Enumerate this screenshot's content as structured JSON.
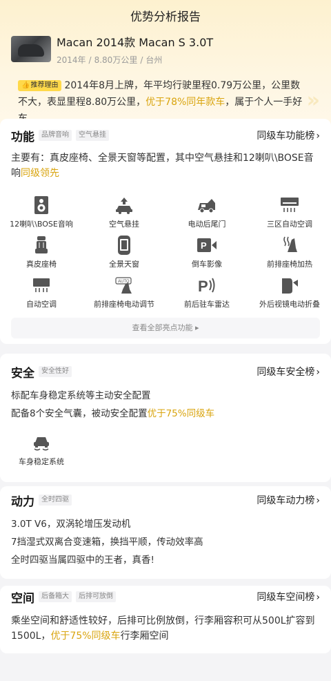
{
  "header": {
    "title": "优势分析报告"
  },
  "car": {
    "name": "Macan 2014款 Macan S 3.0T",
    "year": "2014年",
    "mileage": "8.80万公里",
    "city": "台州"
  },
  "recommend": {
    "badge": "推荐理由",
    "text_before": "2014年8月上牌，年平均行驶里程0.79万公里，公里数不大，表显里程8.80万公里，",
    "highlight": "优于78%同年款车",
    "text_after": "，属于个人一手好车"
  },
  "function_section": {
    "title": "功能",
    "tags": [
      "品牌音响",
      "空气悬挂"
    ],
    "rank_label": "同级车功能榜",
    "desc_before": "主要有：真皮座椅、全景天窗等配置，其中空气悬挂和12喇叭\\BOSE音响",
    "desc_highlight": "同级领先",
    "features": [
      {
        "label": "12喇叭\\BOSE音响",
        "icon": "speaker-icon"
      },
      {
        "label": "空气悬挂",
        "icon": "air-suspension-icon"
      },
      {
        "label": "电动后尾门",
        "icon": "power-tailgate-icon"
      },
      {
        "label": "三区自动空调",
        "icon": "tri-zone-ac-icon"
      },
      {
        "label": "真皮座椅",
        "icon": "leather-seat-icon"
      },
      {
        "label": "全景天窗",
        "icon": "panoramic-sunroof-icon"
      },
      {
        "label": "倒车影像",
        "icon": "reverse-camera-icon"
      },
      {
        "label": "前排座椅加热",
        "icon": "seat-heating-icon"
      },
      {
        "label": "自动空调",
        "icon": "auto-ac-icon"
      },
      {
        "label": "前排座椅电动调节",
        "icon": "power-seat-icon"
      },
      {
        "label": "前后驻车雷达",
        "icon": "parking-radar-icon"
      },
      {
        "label": "外后视镜电动折叠",
        "icon": "mirror-fold-icon"
      }
    ],
    "more_label": "查看全部亮点功能 ▸"
  },
  "safety_section": {
    "title": "安全",
    "tags": [
      "安全性好"
    ],
    "rank_label": "同级车安全榜",
    "line1": "标配车身稳定系统等主动安全配置",
    "line2_before": "配备8个安全气囊，被动安全配置",
    "line2_highlight": "优于75%同级车",
    "features": [
      {
        "label": "车身稳定系统",
        "icon": "stability-control-icon"
      }
    ]
  },
  "power_section": {
    "title": "动力",
    "tags": [
      "全时四驱"
    ],
    "rank_label": "同级车动力榜",
    "lines": [
      "3.0T V6，双涡轮增压发动机",
      "7挡湿式双离合变速箱，换挡平顺，传动效率高",
      "全时四驱当属四驱中的王者，真香!"
    ]
  },
  "space_section": {
    "title": "空间",
    "tags": [
      "后备箱大",
      "后排可放倒"
    ],
    "rank_label": "同级车空间榜",
    "text_before": "乘坐空间和舒适性较好，后排可比例放倒，行李厢容积可从500L扩容到1500L，",
    "highlight": "优于75%同级车",
    "text_after": "行李厢空间"
  },
  "colors": {
    "accent": "#d9a40e",
    "badge": "#ffd94a",
    "header_bg": "#fdf1cf"
  }
}
